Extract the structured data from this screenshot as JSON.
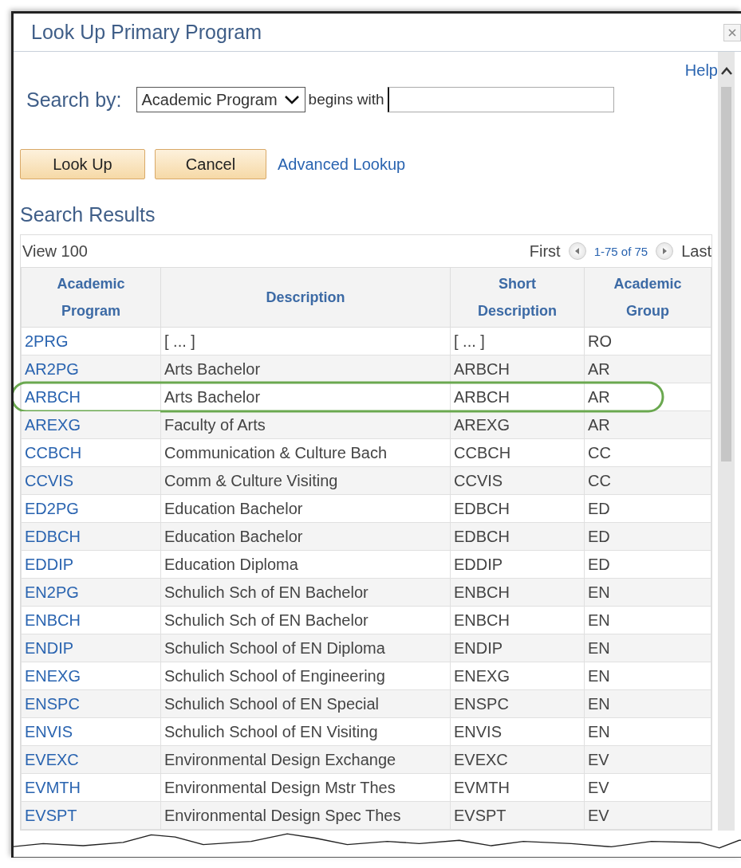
{
  "window": {
    "title": "Look Up Primary Program"
  },
  "help_link": "Help",
  "search": {
    "label": "Search by:",
    "field": "Academic Program",
    "operator": "begins with"
  },
  "buttons": [
    "Look Up",
    "Cancel"
  ],
  "advanced_link": "Advanced Lookup",
  "results": {
    "title": "Search Results",
    "view_link": "View 100",
    "first": "First",
    "range": "1-75 of 75",
    "last": "Last",
    "columns": [
      "Academic Program",
      "Description",
      "Short Description",
      "Academic Group"
    ],
    "rows": [
      {
        "cells": [
          "2PRG",
          "[ ... ]",
          "[ ... ]",
          "RO"
        ],
        "highlighted": false
      },
      {
        "cells": [
          "AR2PG",
          "Arts Bachelor",
          "ARBCH",
          "AR"
        ],
        "highlighted": false
      },
      {
        "cells": [
          "ARBCH",
          "Arts Bachelor",
          "ARBCH",
          "AR"
        ],
        "highlighted": true
      },
      {
        "cells": [
          "AREXG",
          "Faculty of Arts",
          "AREXG",
          "AR"
        ],
        "highlighted": false
      },
      {
        "cells": [
          "CCBCH",
          "Communication & Culture Bach",
          "CCBCH",
          "CC"
        ],
        "highlighted": false
      },
      {
        "cells": [
          "CCVIS",
          "Comm & Culture Visiting",
          "CCVIS",
          "CC"
        ],
        "highlighted": false
      },
      {
        "cells": [
          "ED2PG",
          "Education Bachelor",
          "EDBCH",
          "ED"
        ],
        "highlighted": false
      },
      {
        "cells": [
          "EDBCH",
          "Education Bachelor",
          "EDBCH",
          "ED"
        ],
        "highlighted": false
      },
      {
        "cells": [
          "EDDIP",
          "Education Diploma",
          "EDDIP",
          "ED"
        ],
        "highlighted": false
      },
      {
        "cells": [
          "EN2PG",
          "Schulich Sch of EN Bachelor",
          "ENBCH",
          "EN"
        ],
        "highlighted": false
      },
      {
        "cells": [
          "ENBCH",
          "Schulich Sch of EN Bachelor",
          "ENBCH",
          "EN"
        ],
        "highlighted": false
      },
      {
        "cells": [
          "ENDIP",
          "Schulich School of EN Diploma",
          "ENDIP",
          "EN"
        ],
        "highlighted": false
      },
      {
        "cells": [
          "ENEXG",
          "Schulich School of Engineering",
          "ENEXG",
          "EN"
        ],
        "highlighted": false
      },
      {
        "cells": [
          "ENSPC",
          "Schulich School of EN Special",
          "ENSPC",
          "EN"
        ],
        "highlighted": false
      },
      {
        "cells": [
          "ENVIS",
          "Schulich School of EN Visiting",
          "ENVIS",
          "EN"
        ],
        "highlighted": false
      },
      {
        "cells": [
          "EVEXC",
          "Environmental Design Exchange",
          "EVEXC",
          "EV"
        ],
        "highlighted": false
      },
      {
        "cells": [
          "EVMTH",
          "Environmental Design Mstr Thes",
          "EVMTH",
          "EV"
        ],
        "highlighted": false
      },
      {
        "cells": [
          "EVSPT",
          "Environmental Design Spec Thes",
          "EVSPT",
          "EV"
        ],
        "highlighted": false
      }
    ]
  }
}
